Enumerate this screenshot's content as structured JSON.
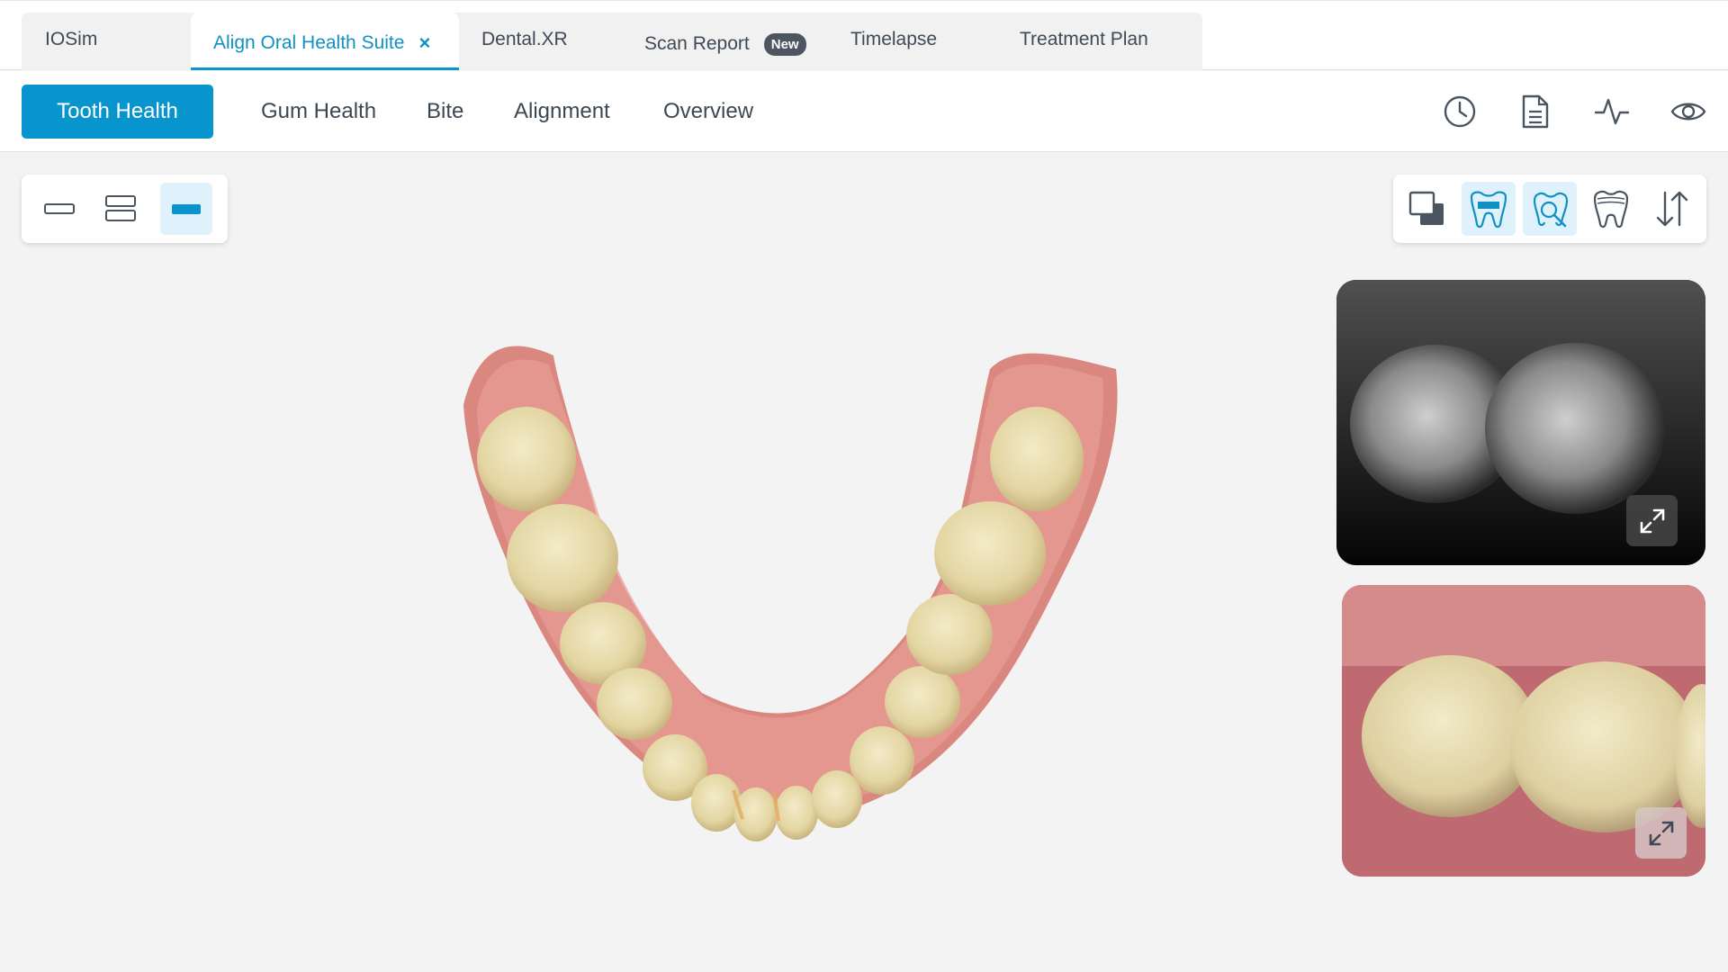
{
  "tabs": [
    {
      "label": "IOSim"
    },
    {
      "label": "Align Oral Health Suite",
      "active": true,
      "close": "×"
    },
    {
      "label": "Dental.XR"
    },
    {
      "label": "Scan Report",
      "badge": "New"
    },
    {
      "label": "Timelapse"
    },
    {
      "label": "Treatment Plan"
    }
  ],
  "nav": {
    "items": [
      "Tooth Health",
      "Gum Health",
      "Bite",
      "Alignment",
      "Overview"
    ],
    "active": "Tooth Health",
    "icons": [
      "clock-icon",
      "document-icon",
      "pulse-icon",
      "eye-icon"
    ]
  },
  "layout_toolbar": {
    "buttons": [
      "single-view-icon",
      "split-view-icon",
      "full-view-icon"
    ],
    "selected": "full-view-icon"
  },
  "view_toolbar": {
    "buttons": [
      "overlay-icon",
      "jaw-toggle-icon",
      "tooth-inspect-icon",
      "tooth-crown-icon",
      "flip-arrows-icon"
    ],
    "selected": [
      "jaw-toggle-icon",
      "tooth-inspect-icon"
    ]
  },
  "thumbnails": [
    {
      "kind": "near-infrared image",
      "expand": "expand-icon"
    },
    {
      "kind": "color intraoral image",
      "expand": "expand-icon"
    }
  ],
  "colors": {
    "accent": "#0894cc",
    "accent_light": "#dff1fa",
    "badge": "#4c5560",
    "background": "#f3f3f3"
  }
}
